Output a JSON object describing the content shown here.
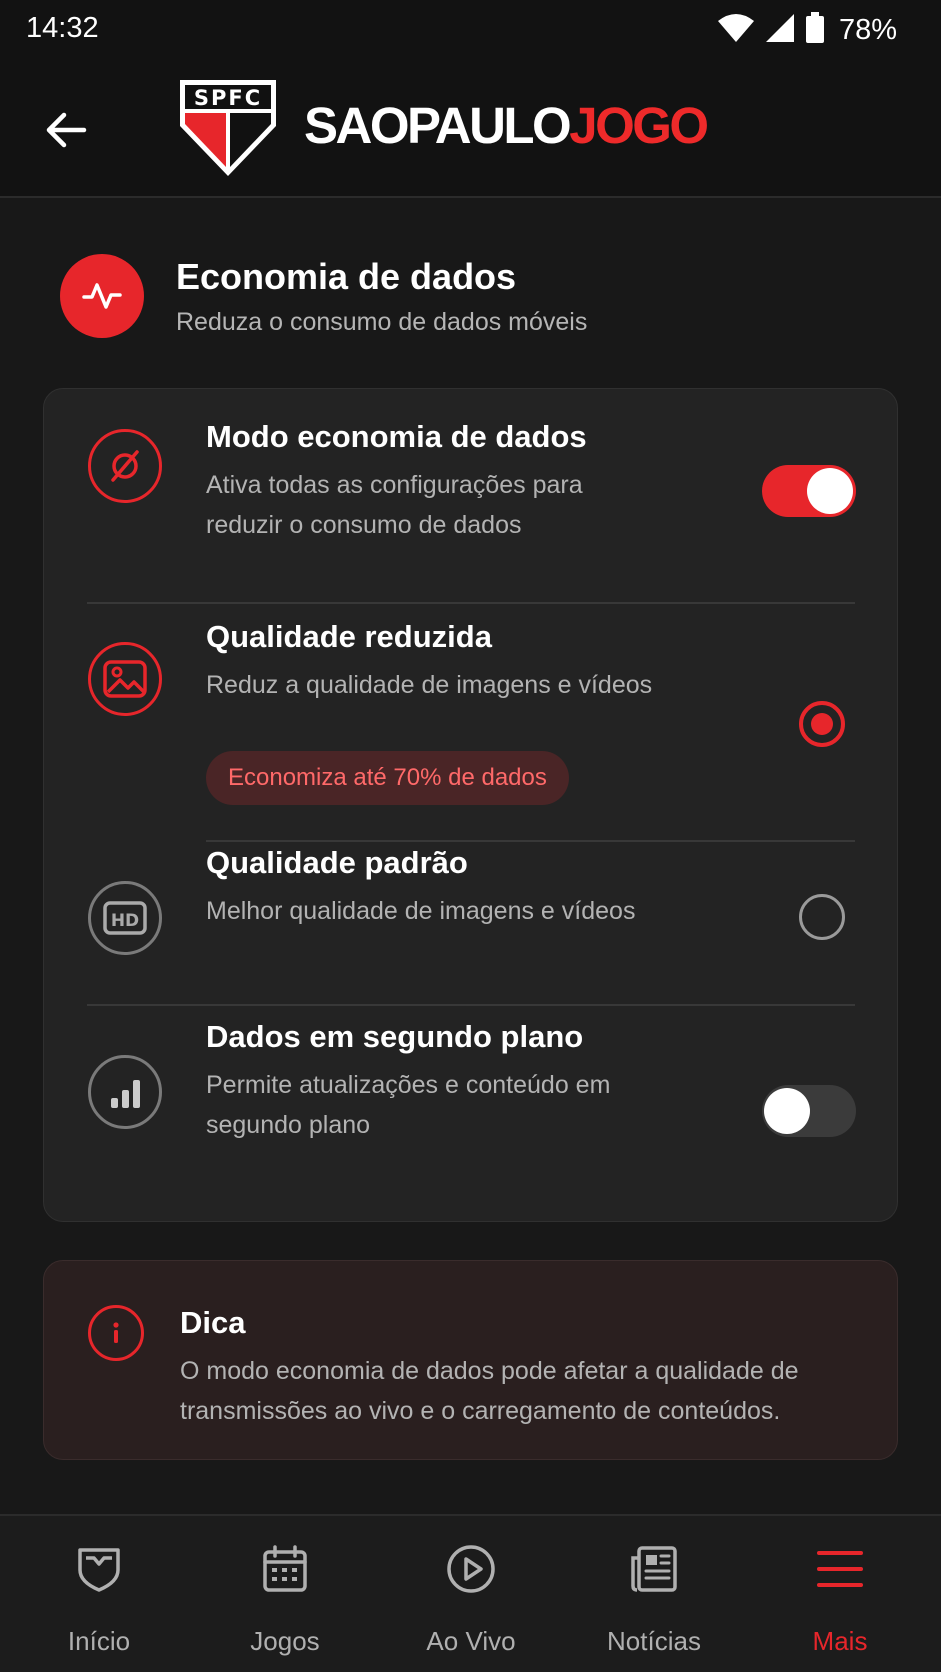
{
  "status_bar": {
    "time": "14:32",
    "battery": "78%",
    "icons": [
      "wifi-icon",
      "signal-icon",
      "battery-icon"
    ]
  },
  "header": {
    "logo_text": "SPFC",
    "brand_part1": "SAOPAULO",
    "brand_part2": "JOGO",
    "back_icon": "arrow-left-icon"
  },
  "section": {
    "title": "Economia de dados",
    "subtitle": "Reduza o consumo de dados móveis",
    "icon": "activity-icon"
  },
  "settings": {
    "data_saver": {
      "title": "Modo economia de dados",
      "desc_line1": "Ativa todas as configurações para",
      "desc_line2": "reduzir o consumo de dados",
      "enabled": true,
      "icon": "no-data-icon"
    },
    "reduced_quality": {
      "title": "Qualidade reduzida",
      "desc": "Reduz a qualidade de imagens e vídeos",
      "badge": "Economiza até 70% de dados",
      "selected": true,
      "icon": "image-icon"
    },
    "standard_quality": {
      "title": "Qualidade padrão",
      "desc": "Melhor qualidade de imagens e vídeos",
      "selected": false,
      "icon": "hd-icon"
    },
    "background_data": {
      "title": "Dados em segundo plano",
      "desc_line1": "Permite atualizações e conteúdo em",
      "desc_line2": "segundo plano",
      "enabled": false,
      "icon": "bar-chart-icon"
    }
  },
  "tip": {
    "title": "Dica",
    "line1": "O modo economia de dados pode afetar a qualidade de",
    "line2": "transmissões ao vivo e o carregamento de conteúdos.",
    "icon": "info-icon"
  },
  "bottom_nav": [
    {
      "label": "Início",
      "icon": "shield-home-icon",
      "active": false
    },
    {
      "label": "Jogos",
      "icon": "calendar-icon",
      "active": false
    },
    {
      "label": "Ao Vivo",
      "icon": "play-circle-icon",
      "active": false
    },
    {
      "label": "Notícias",
      "icon": "newspaper-icon",
      "active": false
    },
    {
      "label": "Mais",
      "icon": "menu-icon",
      "active": true
    }
  ],
  "colors": {
    "accent": "#e7262b",
    "background": "#181818",
    "card": "#232323",
    "tip_card": "#2a1f1f",
    "text_secondary": "#b3b3b3"
  }
}
